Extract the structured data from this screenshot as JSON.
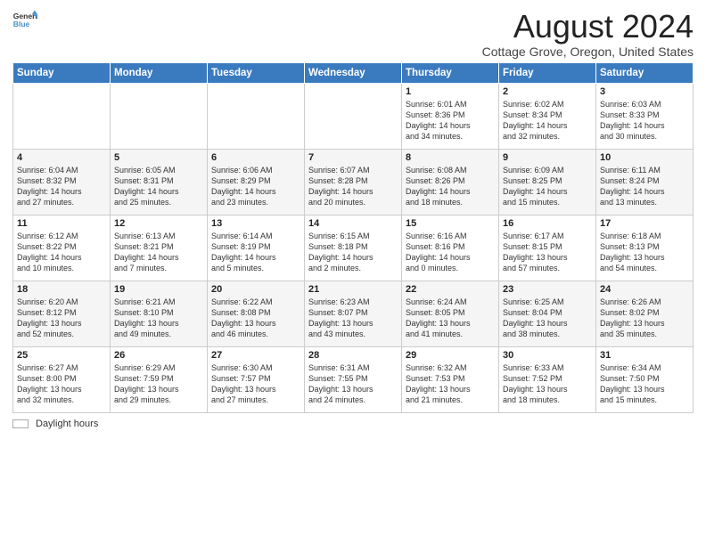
{
  "header": {
    "logo_line1": "General",
    "logo_line2": "Blue",
    "title": "August 2024",
    "subtitle": "Cottage Grove, Oregon, United States"
  },
  "columns": [
    "Sunday",
    "Monday",
    "Tuesday",
    "Wednesday",
    "Thursday",
    "Friday",
    "Saturday"
  ],
  "weeks": [
    [
      {
        "day": "",
        "info": ""
      },
      {
        "day": "",
        "info": ""
      },
      {
        "day": "",
        "info": ""
      },
      {
        "day": "",
        "info": ""
      },
      {
        "day": "1",
        "info": "Sunrise: 6:01 AM\nSunset: 8:36 PM\nDaylight: 14 hours\nand 34 minutes."
      },
      {
        "day": "2",
        "info": "Sunrise: 6:02 AM\nSunset: 8:34 PM\nDaylight: 14 hours\nand 32 minutes."
      },
      {
        "day": "3",
        "info": "Sunrise: 6:03 AM\nSunset: 8:33 PM\nDaylight: 14 hours\nand 30 minutes."
      }
    ],
    [
      {
        "day": "4",
        "info": "Sunrise: 6:04 AM\nSunset: 8:32 PM\nDaylight: 14 hours\nand 27 minutes."
      },
      {
        "day": "5",
        "info": "Sunrise: 6:05 AM\nSunset: 8:31 PM\nDaylight: 14 hours\nand 25 minutes."
      },
      {
        "day": "6",
        "info": "Sunrise: 6:06 AM\nSunset: 8:29 PM\nDaylight: 14 hours\nand 23 minutes."
      },
      {
        "day": "7",
        "info": "Sunrise: 6:07 AM\nSunset: 8:28 PM\nDaylight: 14 hours\nand 20 minutes."
      },
      {
        "day": "8",
        "info": "Sunrise: 6:08 AM\nSunset: 8:26 PM\nDaylight: 14 hours\nand 18 minutes."
      },
      {
        "day": "9",
        "info": "Sunrise: 6:09 AM\nSunset: 8:25 PM\nDaylight: 14 hours\nand 15 minutes."
      },
      {
        "day": "10",
        "info": "Sunrise: 6:11 AM\nSunset: 8:24 PM\nDaylight: 14 hours\nand 13 minutes."
      }
    ],
    [
      {
        "day": "11",
        "info": "Sunrise: 6:12 AM\nSunset: 8:22 PM\nDaylight: 14 hours\nand 10 minutes."
      },
      {
        "day": "12",
        "info": "Sunrise: 6:13 AM\nSunset: 8:21 PM\nDaylight: 14 hours\nand 7 minutes."
      },
      {
        "day": "13",
        "info": "Sunrise: 6:14 AM\nSunset: 8:19 PM\nDaylight: 14 hours\nand 5 minutes."
      },
      {
        "day": "14",
        "info": "Sunrise: 6:15 AM\nSunset: 8:18 PM\nDaylight: 14 hours\nand 2 minutes."
      },
      {
        "day": "15",
        "info": "Sunrise: 6:16 AM\nSunset: 8:16 PM\nDaylight: 14 hours\nand 0 minutes."
      },
      {
        "day": "16",
        "info": "Sunrise: 6:17 AM\nSunset: 8:15 PM\nDaylight: 13 hours\nand 57 minutes."
      },
      {
        "day": "17",
        "info": "Sunrise: 6:18 AM\nSunset: 8:13 PM\nDaylight: 13 hours\nand 54 minutes."
      }
    ],
    [
      {
        "day": "18",
        "info": "Sunrise: 6:20 AM\nSunset: 8:12 PM\nDaylight: 13 hours\nand 52 minutes."
      },
      {
        "day": "19",
        "info": "Sunrise: 6:21 AM\nSunset: 8:10 PM\nDaylight: 13 hours\nand 49 minutes."
      },
      {
        "day": "20",
        "info": "Sunrise: 6:22 AM\nSunset: 8:08 PM\nDaylight: 13 hours\nand 46 minutes."
      },
      {
        "day": "21",
        "info": "Sunrise: 6:23 AM\nSunset: 8:07 PM\nDaylight: 13 hours\nand 43 minutes."
      },
      {
        "day": "22",
        "info": "Sunrise: 6:24 AM\nSunset: 8:05 PM\nDaylight: 13 hours\nand 41 minutes."
      },
      {
        "day": "23",
        "info": "Sunrise: 6:25 AM\nSunset: 8:04 PM\nDaylight: 13 hours\nand 38 minutes."
      },
      {
        "day": "24",
        "info": "Sunrise: 6:26 AM\nSunset: 8:02 PM\nDaylight: 13 hours\nand 35 minutes."
      }
    ],
    [
      {
        "day": "25",
        "info": "Sunrise: 6:27 AM\nSunset: 8:00 PM\nDaylight: 13 hours\nand 32 minutes."
      },
      {
        "day": "26",
        "info": "Sunrise: 6:29 AM\nSunset: 7:59 PM\nDaylight: 13 hours\nand 29 minutes."
      },
      {
        "day": "27",
        "info": "Sunrise: 6:30 AM\nSunset: 7:57 PM\nDaylight: 13 hours\nand 27 minutes."
      },
      {
        "day": "28",
        "info": "Sunrise: 6:31 AM\nSunset: 7:55 PM\nDaylight: 13 hours\nand 24 minutes."
      },
      {
        "day": "29",
        "info": "Sunrise: 6:32 AM\nSunset: 7:53 PM\nDaylight: 13 hours\nand 21 minutes."
      },
      {
        "day": "30",
        "info": "Sunrise: 6:33 AM\nSunset: 7:52 PM\nDaylight: 13 hours\nand 18 minutes."
      },
      {
        "day": "31",
        "info": "Sunrise: 6:34 AM\nSunset: 7:50 PM\nDaylight: 13 hours\nand 15 minutes."
      }
    ]
  ],
  "footer": {
    "daylight_label": "Daylight hours"
  }
}
